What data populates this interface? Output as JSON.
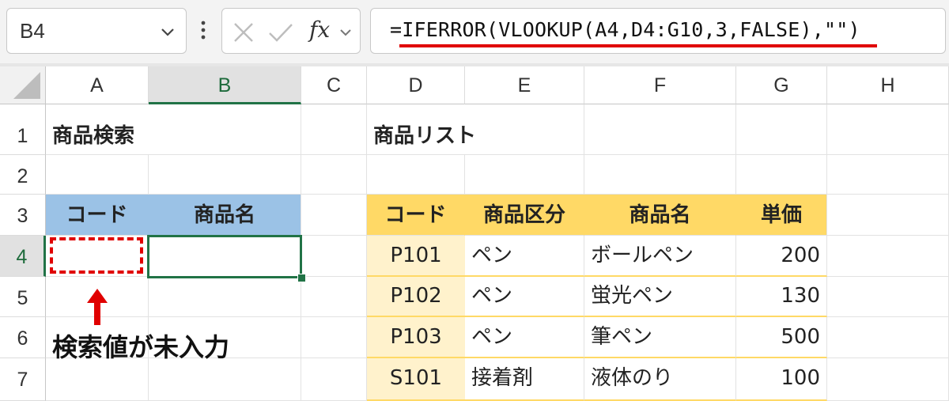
{
  "formula_bar": {
    "name_box": "B4",
    "cancel_icon": "x-icon",
    "enter_icon": "check-icon",
    "fx_label": "fx",
    "formula": "=IFERROR(VLOOKUP(A4,D4:G10,3,FALSE),\"\")"
  },
  "columns": [
    "A",
    "B",
    "C",
    "D",
    "E",
    "F",
    "G",
    "H"
  ],
  "selected_column": "B",
  "rows": [
    "1",
    "2",
    "3",
    "4",
    "5",
    "6",
    "7"
  ],
  "selected_row": "4",
  "search": {
    "title": "商品検索",
    "header_code": "コード",
    "header_name": "商品名",
    "code_value": "",
    "name_value": ""
  },
  "product_list": {
    "title": "商品リスト",
    "headers": [
      "コード",
      "商品区分",
      "商品名",
      "単価"
    ],
    "rows": [
      [
        "P101",
        "ペン",
        "ボールペン",
        "200"
      ],
      [
        "P102",
        "ペン",
        "蛍光ペン",
        "130"
      ],
      [
        "P103",
        "ペン",
        "筆ペン",
        "500"
      ],
      [
        "S101",
        "接着剤",
        "液体のり",
        "100"
      ]
    ]
  },
  "annotation": {
    "note": "検索値が未入力",
    "highlight_color": "#e00000"
  },
  "colors": {
    "search_header": "#9bc2e6",
    "list_header": "#ffd966",
    "list_code_fill": "#fff2cc",
    "selection": "#217346"
  }
}
